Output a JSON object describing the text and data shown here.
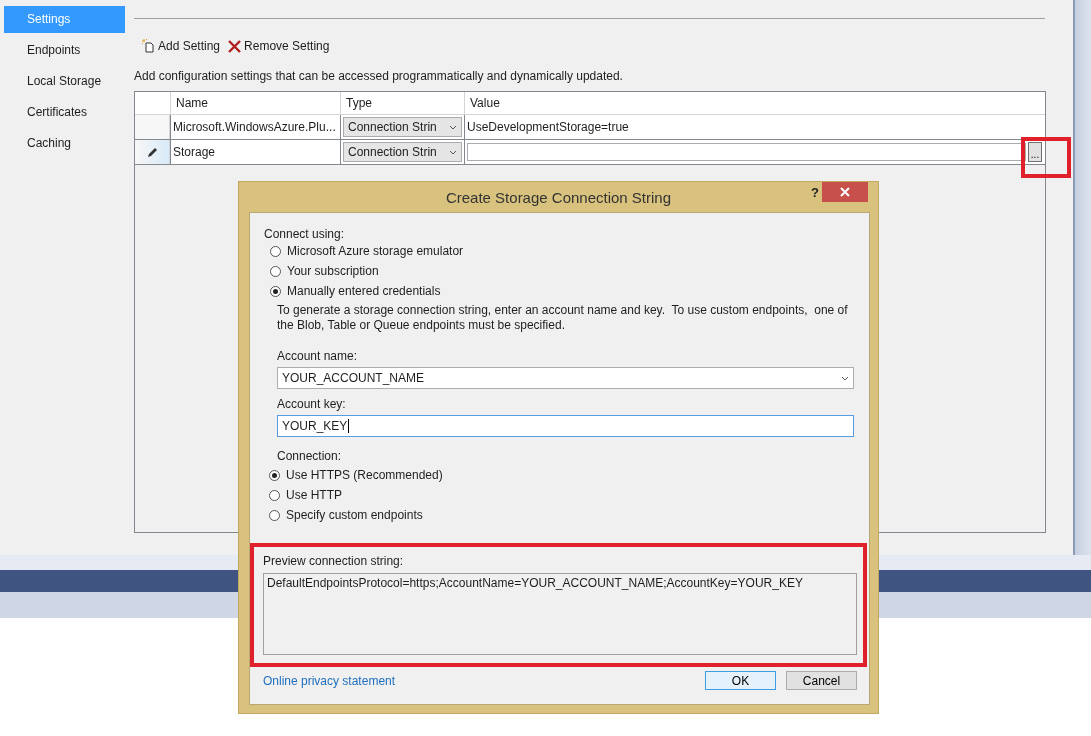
{
  "sidebar": {
    "items": [
      {
        "label": "Settings",
        "selected": true
      },
      {
        "label": "Endpoints",
        "selected": false
      },
      {
        "label": "Local Storage",
        "selected": false
      },
      {
        "label": "Certificates",
        "selected": false
      },
      {
        "label": "Caching",
        "selected": false
      }
    ]
  },
  "toolbar": [
    {
      "kind": "add",
      "label": "Add Setting"
    },
    {
      "kind": "remove",
      "label": "Remove Setting"
    }
  ],
  "description": "Add configuration settings that can be accessed programmatically and dynamically updated.",
  "table": {
    "columns": [
      "Name",
      "Type",
      "Value"
    ],
    "rows": [
      {
        "editing": false,
        "name": "Microsoft.WindowsAzure.Plu...",
        "type": "Connection Strin",
        "value": "UseDevelopmentStorage=true"
      },
      {
        "editing": true,
        "name": "Storage",
        "type": "Connection Strin",
        "browse_button": "..."
      }
    ]
  },
  "dialog": {
    "title": "Create Storage Connection String",
    "help": "?",
    "connect_label": "Connect using:",
    "connect_options": [
      {
        "label": "Microsoft Azure storage emulator",
        "selected": false
      },
      {
        "label": "Your subscription",
        "selected": false
      },
      {
        "label": "Manually entered credentials",
        "selected": true
      }
    ],
    "hint": "To generate a storage connection string, enter an account name and key.  To use custom endpoints,  one of the Blob, Table or Queue endpoints must be specified.",
    "account_name": {
      "label": "Account name:",
      "value": "YOUR_ACCOUNT_NAME"
    },
    "account_key": {
      "label": "Account key:",
      "value": "YOUR_KEY",
      "focused": true
    },
    "connection_label": "Connection:",
    "connection_options": [
      {
        "label": "Use HTTPS (Recommended)",
        "selected": true
      },
      {
        "label": "Use HTTP",
        "selected": false
      },
      {
        "label": "Specify custom endpoints",
        "selected": false
      }
    ],
    "preview": {
      "label": "Preview connection string:",
      "value": "DefaultEndpointsProtocol=https;AccountName=YOUR_ACCOUNT_NAME;AccountKey=YOUR_KEY"
    },
    "privacy_link": "Online privacy statement",
    "buttons": [
      {
        "label": "OK",
        "default": true
      },
      {
        "label": "Cancel",
        "default": false
      }
    ]
  }
}
